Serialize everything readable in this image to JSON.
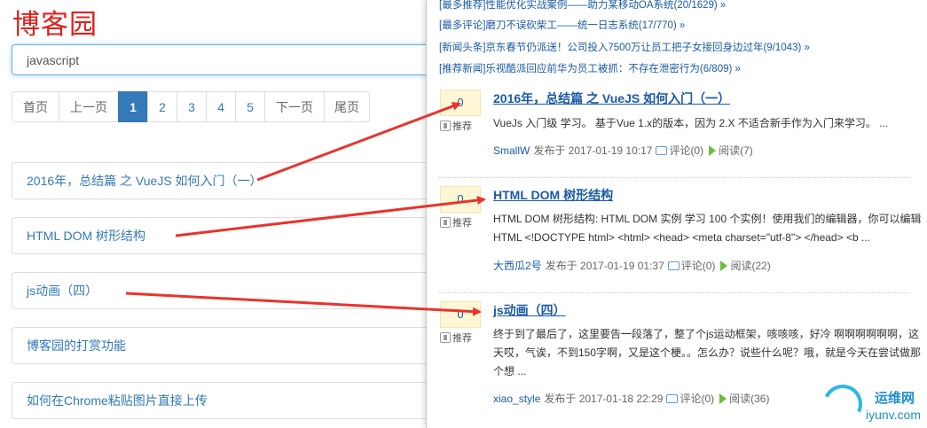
{
  "left": {
    "logo": "博客园",
    "search_value": "javascript",
    "pager": [
      {
        "label": "首页",
        "kind": "first"
      },
      {
        "label": "上一页",
        "kind": "gray"
      },
      {
        "label": "1",
        "kind": "active"
      },
      {
        "label": "2",
        "kind": "num"
      },
      {
        "label": "3",
        "kind": "num"
      },
      {
        "label": "4",
        "kind": "num"
      },
      {
        "label": "5",
        "kind": "num"
      },
      {
        "label": "下一页",
        "kind": "gray"
      },
      {
        "label": "尾页",
        "kind": "last"
      }
    ],
    "results": [
      "2016年，总结篇 之 VueJS 如何入门（一）",
      "HTML DOM 树形结构",
      "js动画（四）",
      "博客园的打赏功能",
      "如何在Chrome粘贴图片直接上传"
    ]
  },
  "right": {
    "news": [
      "[最多推荐]性能优化实战案例——助力某移动OA系统(20/1629) »",
      "[最多评论]磨刀不误砍柴工——统一日志系统(17/770) »",
      "[新闻头条]京东春节仍派送！公司投入7500万让员工把子女接回身边过年(9/1043) »",
      "[推荐新闻]乐视酷派回应前华为员工被抓：不存在泄密行为(6/809) »"
    ],
    "posts": [
      {
        "votes": "0",
        "recommend": "推荐",
        "title": "2016年，总结篇 之 VueJS 如何入门（一）",
        "summary": "VueJs 入门级 学习。 基于Vue 1.x的版本，因为 2.X 不适合新手作为入门来学习。 ...",
        "author": "SmallW",
        "posted": "发布于 2017-01-19 10:17",
        "comments": "评论(0)",
        "reads": "阅读(7)"
      },
      {
        "votes": "0",
        "recommend": "推荐",
        "title": "HTML DOM 树形结构",
        "summary": "HTML DOM 树形结构: HTML DOM 实例 学习 100 个实例！使用我们的编辑器，你可以编辑 HTML <!DOCTYPE html> <html> <head> <meta charset=\"utf-8\"> </head> <b ...",
        "author": "大西瓜2号",
        "posted": "发布于 2017-01-19 01:37",
        "comments": "评论(0)",
        "reads": "阅读(22)"
      },
      {
        "votes": "0",
        "recommend": "推荐",
        "title": "js动画（四）",
        "summary": "终于到了最后了，这里要告一段落了，整了个js运动框架，咳咳咳，好冷 啊啊啊啊啊啊，这天哎，气诶，不到150字啊，又是这个梗。。怎么办？说些什么呢？哦，就是今天在尝试做那个想 ...",
        "author": "xiao_style",
        "posted": "发布于 2017-01-18 22:29",
        "comments": "评论(0)",
        "reads": "阅读(36)"
      }
    ]
  },
  "watermark": {
    "line1": "运维网",
    "line2": "iyunv.com"
  },
  "colors": {
    "logo": "#e0201c",
    "link": "#337ab7",
    "arrow": "#e8342c"
  }
}
